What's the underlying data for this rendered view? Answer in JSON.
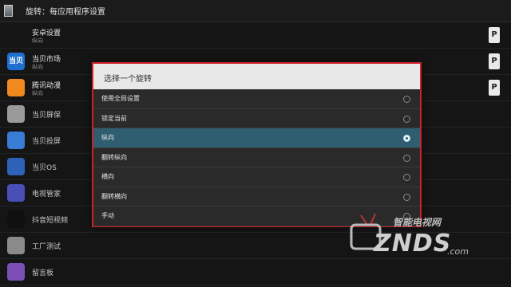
{
  "title": "旋转：每应用程序设置",
  "apps": [
    {
      "name": "安卓设置",
      "sub": "纵向",
      "icon_color": "transparent",
      "icon_text": "",
      "p": true
    },
    {
      "name": "当贝市场",
      "sub": "纵向",
      "icon_color": "#1e6fcf",
      "icon_text": "当贝",
      "p": true
    },
    {
      "name": "腾讯动漫",
      "sub": "纵向",
      "icon_color": "#f08a1c",
      "icon_text": "",
      "p": true
    },
    {
      "name": "当贝屏保",
      "sub": "",
      "icon_color": "#9a9a9a",
      "icon_text": "",
      "p": false
    },
    {
      "name": "当贝投屏",
      "sub": "",
      "icon_color": "#3a7bd5",
      "icon_text": "",
      "p": false
    },
    {
      "name": "当贝OS",
      "sub": "",
      "icon_color": "#2e62b8",
      "icon_text": "",
      "p": false
    },
    {
      "name": "电视管家",
      "sub": "",
      "icon_color": "#4a4fb8",
      "icon_text": "",
      "p": false
    },
    {
      "name": "抖音短视频",
      "sub": "",
      "icon_color": "#101010",
      "icon_text": "",
      "p": false
    },
    {
      "name": "工厂测试",
      "sub": "",
      "icon_color": "#8a8a8a",
      "icon_text": "",
      "p": false
    },
    {
      "name": "留言板",
      "sub": "",
      "icon_color": "#7b4fb8",
      "icon_text": "",
      "p": false
    }
  ],
  "p_label": "P",
  "dialog": {
    "title": "选择一个旋转",
    "options": [
      "使用全局设置",
      "锁定当前",
      "纵向",
      "翻转纵向",
      "横向",
      "翻转横向",
      "手动"
    ],
    "selected_index": 2
  },
  "watermark": {
    "top": "智能电视网",
    "main": "ZNDS",
    "domain": ".com"
  }
}
